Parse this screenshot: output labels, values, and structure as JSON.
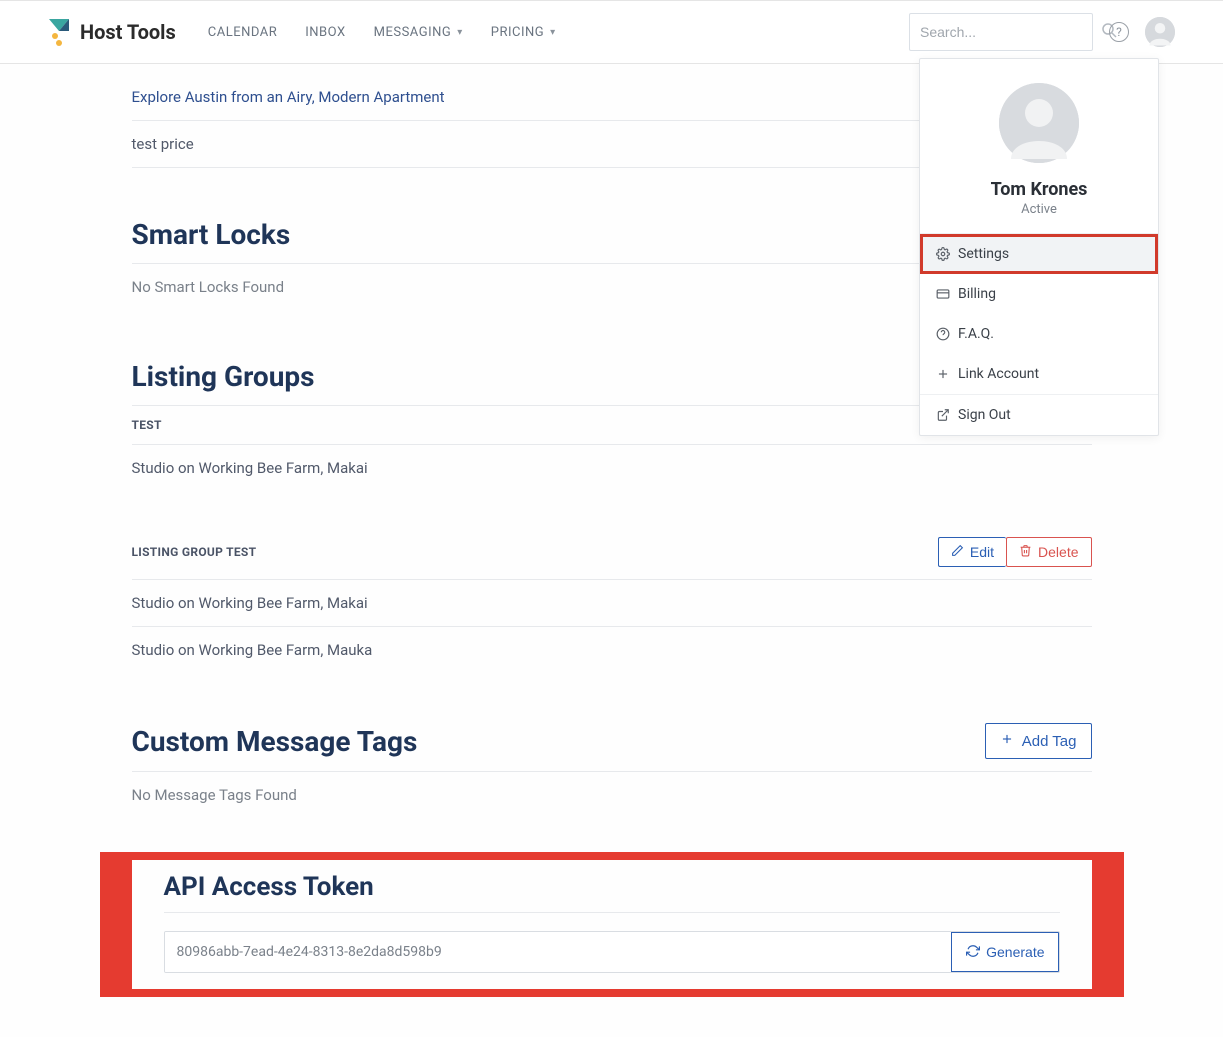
{
  "brand": {
    "name": "Host Tools"
  },
  "nav": {
    "calendar": "CALENDAR",
    "inbox": "INBOX",
    "messaging": "MESSAGING",
    "pricing": "PRICING"
  },
  "search": {
    "placeholder": "Search..."
  },
  "user_menu": {
    "name": "Tom Krones",
    "status": "Active",
    "settings": "Settings",
    "billing": "Billing",
    "faq": "F.A.Q.",
    "link_account": "Link Account",
    "sign_out": "Sign Out"
  },
  "listings": {
    "row1": "Explore Austin from an Airy, Modern Apartment",
    "row2": "test price"
  },
  "smart_locks": {
    "heading": "Smart Locks",
    "empty": "No Smart Locks Found"
  },
  "listing_groups": {
    "heading": "Listing Groups",
    "group1_label": "TEST",
    "group1_item1": "Studio on Working Bee Farm, Makai",
    "group2_label": "LISTING GROUP TEST",
    "group2_item1": "Studio on Working Bee Farm, Makai",
    "group2_item2": "Studio on Working Bee Farm, Mauka",
    "edit": "Edit",
    "delete": "Delete"
  },
  "message_tags": {
    "heading": "Custom Message Tags",
    "empty": "No Message Tags Found",
    "add": "Add Tag"
  },
  "api_token": {
    "heading": "API Access Token",
    "value": "80986abb-7ead-4e24-8313-8e2da8d598b9",
    "generate": "Generate"
  },
  "colors": {
    "accent_blue": "#2b5fb4",
    "danger_red": "#d9534f",
    "highlight_red": "#e53b30",
    "heading_navy": "#1f3558"
  }
}
